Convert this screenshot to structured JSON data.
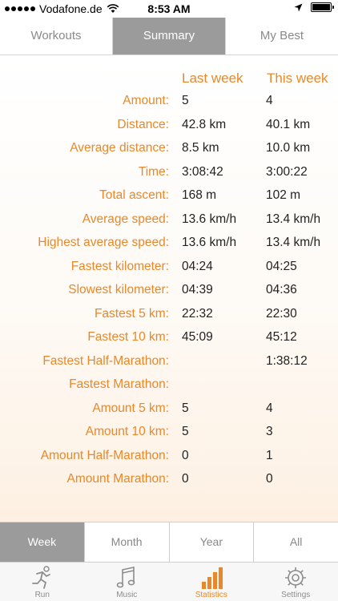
{
  "status_bar": {
    "carrier": "Vodafone.de",
    "time": "8:53 AM"
  },
  "top_tabs": [
    {
      "label": "Workouts",
      "active": false
    },
    {
      "label": "Summary",
      "active": true
    },
    {
      "label": "My Best",
      "active": false
    }
  ],
  "summary": {
    "headers": {
      "last_week": "Last week",
      "this_week": "This week"
    },
    "rows": [
      {
        "label": "Amount:",
        "last_week": "5",
        "this_week": "4"
      },
      {
        "label": "Distance:",
        "last_week": "42.8 km",
        "this_week": "40.1 km"
      },
      {
        "label": "Average distance:",
        "last_week": "8.5 km",
        "this_week": "10.0 km"
      },
      {
        "label": "Time:",
        "last_week": "3:08:42",
        "this_week": "3:00:22"
      },
      {
        "label": "Total ascent:",
        "last_week": "168 m",
        "this_week": "102 m"
      },
      {
        "label": "Average speed:",
        "last_week": "13.6 km/h",
        "this_week": "13.4 km/h"
      },
      {
        "label": "Highest average speed:",
        "last_week": "13.6 km/h",
        "this_week": "13.4 km/h"
      },
      {
        "label": "Fastest kilometer:",
        "last_week": "04:24",
        "this_week": "04:25"
      },
      {
        "label": "Slowest kilometer:",
        "last_week": "04:39",
        "this_week": "04:36"
      },
      {
        "label": "Fastest 5 km:",
        "last_week": "22:32",
        "this_week": "22:30"
      },
      {
        "label": "Fastest 10 km:",
        "last_week": "45:09",
        "this_week": "45:12"
      },
      {
        "label": "Fastest Half-Marathon:",
        "last_week": "",
        "this_week": "1:38:12"
      },
      {
        "label": "Fastest Marathon:",
        "last_week": "",
        "this_week": ""
      },
      {
        "label": "Amount 5 km:",
        "last_week": "5",
        "this_week": "4"
      },
      {
        "label": "Amount 10 km:",
        "last_week": "5",
        "this_week": "3"
      },
      {
        "label": "Amount Half-Marathon:",
        "last_week": "0",
        "this_week": "1"
      },
      {
        "label": "Amount Marathon:",
        "last_week": "0",
        "this_week": "0"
      }
    ]
  },
  "period_tabs": [
    {
      "label": "Week",
      "active": true
    },
    {
      "label": "Month",
      "active": false
    },
    {
      "label": "Year",
      "active": false
    },
    {
      "label": "All",
      "active": false
    }
  ],
  "tab_bar": [
    {
      "label": "Run",
      "icon": "runner-icon",
      "active": false
    },
    {
      "label": "Music",
      "icon": "music-note-icon",
      "active": false
    },
    {
      "label": "Statistics",
      "icon": "bar-chart-icon",
      "active": true
    },
    {
      "label": "Settings",
      "icon": "gear-icon",
      "active": false
    }
  ],
  "colors": {
    "accent": "#e8882a",
    "segment_active": "#9b9b9b"
  }
}
